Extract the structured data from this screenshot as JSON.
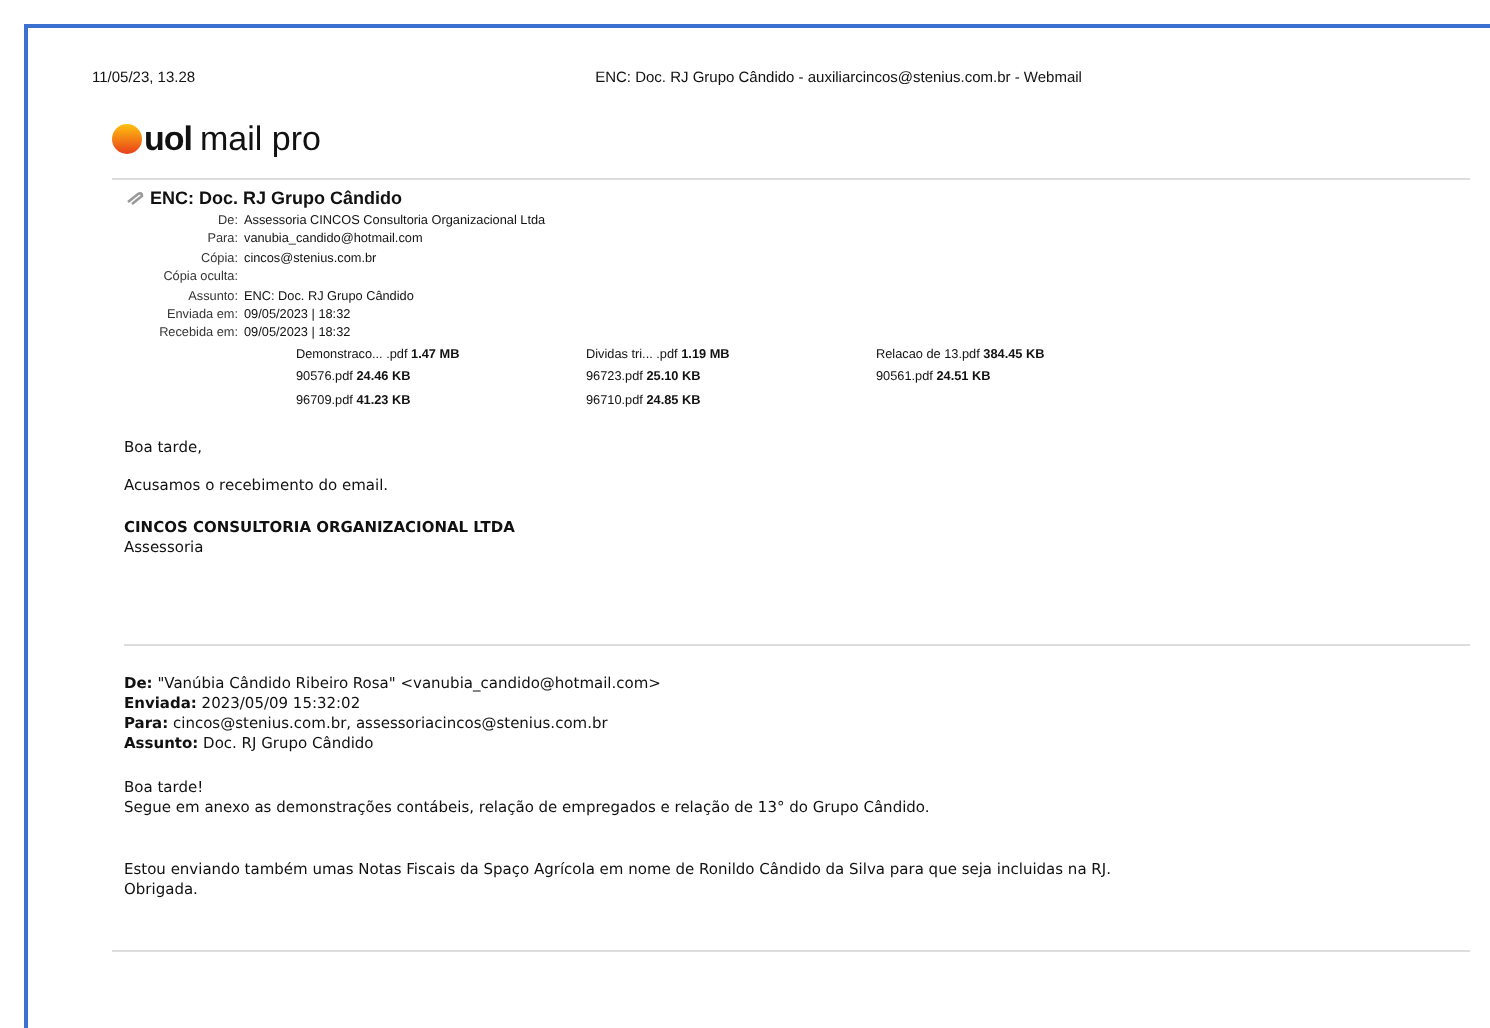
{
  "print_header": {
    "date": "11/05/23, 13.28",
    "title": "ENC: Doc. RJ Grupo Cândido - auxiliarcincos@stenius.com.br - Webmail"
  },
  "logo": {
    "brand": "uol",
    "product": "mail pro"
  },
  "message": {
    "subject": "ENC: Doc. RJ Grupo Cândido",
    "fields": [
      {
        "label": "De:",
        "value": "Assessoria CINCOS Consultoria Organizacional Ltda"
      },
      {
        "label": "Para:",
        "value": "vanubia_candido@hotmail.com"
      },
      {
        "label": "Cópia:",
        "value": "cincos@stenius.com.br"
      },
      {
        "label": "Cópia oculta:"
      },
      {
        "label": "Assunto:",
        "value": "ENC: Doc. RJ Grupo Cândido"
      },
      {
        "label": "Enviada em:",
        "value": "09/05/2023 | 18:32"
      },
      {
        "label": "Recebida em:",
        "value": "09/05/2023 | 18:32"
      }
    ],
    "attachments": [
      {
        "name": "Demonstraco... .pdf",
        "size": "1.47 MB"
      },
      {
        "name": "Dividas tri... .pdf",
        "size": "1.19 MB"
      },
      {
        "name": "Relacao de 13.pdf",
        "size": "384.45 KB"
      },
      {
        "name": "90576.pdf",
        "size": "24.46 KB"
      },
      {
        "name": "96723.pdf",
        "size": "25.10 KB"
      },
      {
        "name": "90561.pdf",
        "size": "24.51 KB"
      },
      {
        "name": "96709.pdf",
        "size": "41.23 KB"
      },
      {
        "name": "96710.pdf",
        "size": "24.85 KB"
      }
    ],
    "body": [
      "Boa tarde,",
      "Acusamos o recebimento do email."
    ],
    "signature": {
      "company": "CINCOS CONSULTORIA ORGANIZACIONAL LTDA",
      "department": "Assessoria"
    }
  },
  "quoted": {
    "headers": [
      "**De:** \"Vanúbia Cândido Ribeiro Rosa\" <vanubia_candido@hotmail.com>",
      "**Enviada:** 2023/05/09 15:32:02",
      "**Para:** cincos@stenius.com.br, assessoriacincos@stenius.com.br",
      "**Assunto:** Doc. RJ Grupo Cândido"
    ],
    "paragraphs": [
      [
        "Boa tarde!",
        "Segue em anexo as demonstrações contábeis, relação de empregados e relação de 13° do Grupo Cândido."
      ],
      [
        "Estou enviando também umas Notas Fiscais da Spaço Agrícola em nome de Ronildo Cândido da Silva para que seja incluidas na RJ.",
        "Obrigada."
      ]
    ]
  }
}
